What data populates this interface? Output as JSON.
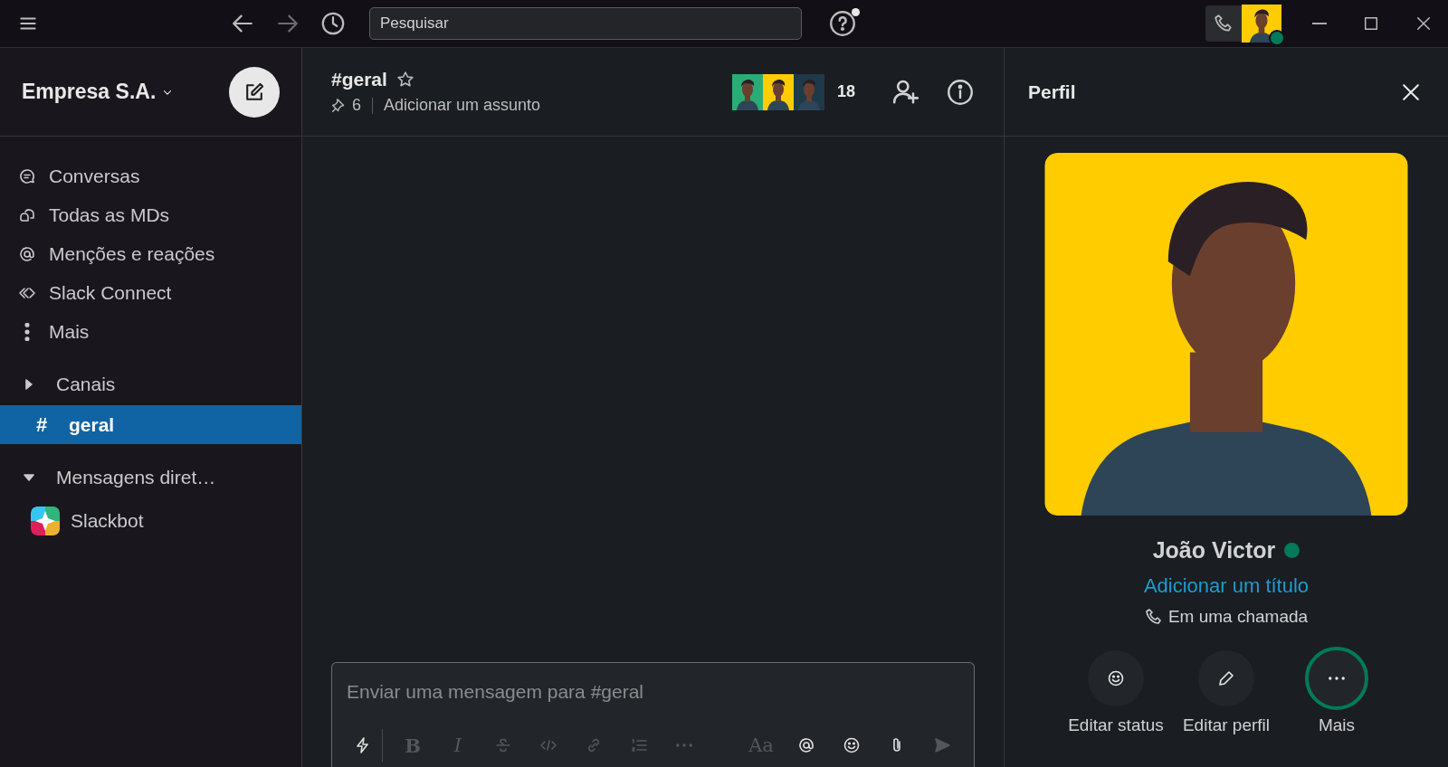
{
  "titlebar": {
    "search": {
      "placeholder": "Pesquisar"
    },
    "help_has_notification": true,
    "in_call": true,
    "user_online": true
  },
  "workspace": {
    "name": "Empresa S.A."
  },
  "nav_items": [
    {
      "kind": "threads",
      "label": "Conversas",
      "selected": false
    },
    {
      "kind": "dms",
      "label": "Todas as MDs",
      "selected": false
    },
    {
      "kind": "mentions",
      "label": "Menções e reações",
      "selected": false
    },
    {
      "kind": "connect",
      "label": "Slack Connect",
      "selected": false
    },
    {
      "kind": "more",
      "label": "Mais",
      "selected": false
    }
  ],
  "sections": [
    {
      "label": "Canais",
      "expanded": false,
      "items": [
        {
          "kind": "channel",
          "prefix": "#",
          "label": "geral",
          "selected": true
        }
      ]
    },
    {
      "label": "Mensagens diret…",
      "expanded": true,
      "items": [
        {
          "kind": "bot",
          "label": "Slackbot",
          "selected": false
        }
      ]
    }
  ],
  "channel": {
    "name": "#geral",
    "starred": false,
    "pinned_count": "6",
    "topic": "Adicionar um assunto",
    "member_count": "18"
  },
  "composer": {
    "placeholder": "Enviar uma mensagem para #geral",
    "toolbar": [
      {
        "kind": "shortcuts",
        "disabled": false
      },
      {
        "kind": "bold",
        "glyph": "B",
        "disabled": true
      },
      {
        "kind": "italic",
        "glyph": "I",
        "disabled": true
      },
      {
        "kind": "strike",
        "disabled": true
      },
      {
        "kind": "code",
        "disabled": true
      },
      {
        "kind": "link",
        "disabled": true
      },
      {
        "kind": "list",
        "disabled": true
      },
      {
        "kind": "more",
        "disabled": true
      },
      {
        "kind": "format",
        "glyph": "Aa",
        "disabled": true
      },
      {
        "kind": "mention",
        "disabled": false
      },
      {
        "kind": "emoji",
        "disabled": false
      },
      {
        "kind": "attach",
        "disabled": false
      },
      {
        "kind": "send",
        "disabled": true
      }
    ]
  },
  "profile": {
    "title": "Perfil",
    "name": "João Victor",
    "online": true,
    "title_link": "Adicionar um título",
    "status": "Em uma chamada",
    "actions": [
      {
        "kind": "status",
        "label": "Editar status",
        "selected": false
      },
      {
        "kind": "edit",
        "label": "Editar perfil",
        "selected": false
      },
      {
        "kind": "more",
        "label": "Mais",
        "selected": true
      }
    ]
  }
}
